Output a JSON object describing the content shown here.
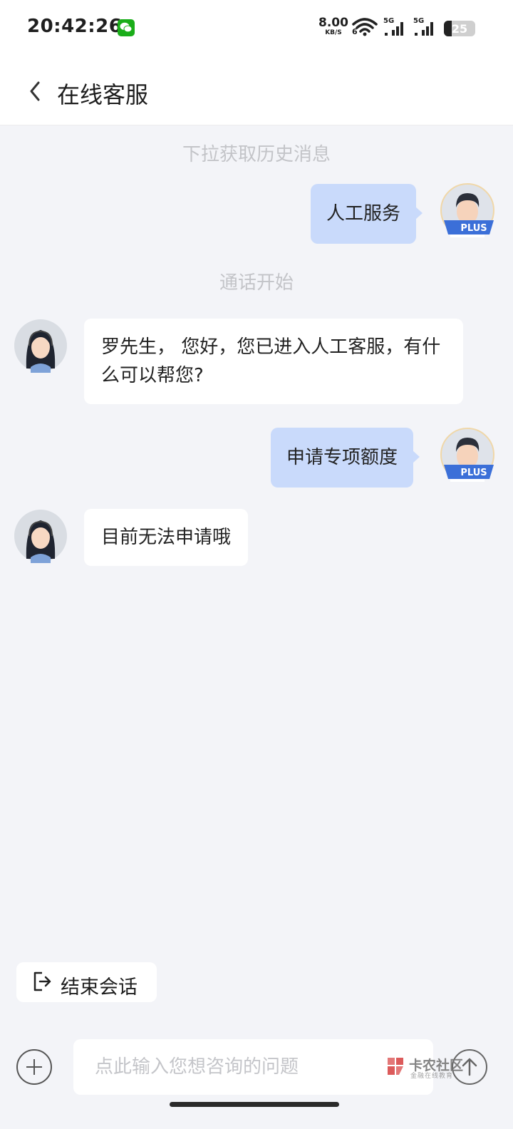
{
  "status_bar": {
    "time": "20:42:26",
    "net_speed_value": "8.00",
    "net_speed_unit": "KB/S",
    "net_type": "6",
    "sim1_label": "5G",
    "sim2_label": "5G",
    "battery": "25",
    "battery_level_percent": 25,
    "app_icon": "wechat-icon"
  },
  "header": {
    "title": "在线客服",
    "back_icon": "chevron-left-icon"
  },
  "chat": {
    "history_hint": "下拉获取历史消息",
    "call_started": "通话开始",
    "messages": [
      {
        "from": "user",
        "text": "人工服务"
      },
      {
        "from": "agent",
        "text": "罗先生， 您好，您已进入人工客服，有什么可以帮您?"
      },
      {
        "from": "user",
        "text": "申请专项额度"
      },
      {
        "from": "agent",
        "text": "目前无法申请哦"
      }
    ],
    "user_badge": "PLUS"
  },
  "actions": {
    "end_session_label": "结束会话"
  },
  "input": {
    "placeholder": "点此输入您想咨询的问题",
    "value": ""
  },
  "watermark": {
    "title": "卡农社区",
    "subtitle": "金融在线教育"
  },
  "colors": {
    "user_bubble": "#c9dafb",
    "agent_bubble": "#ffffff",
    "background": "#f3f4f8",
    "plus_badge": "#3b6fd8"
  }
}
